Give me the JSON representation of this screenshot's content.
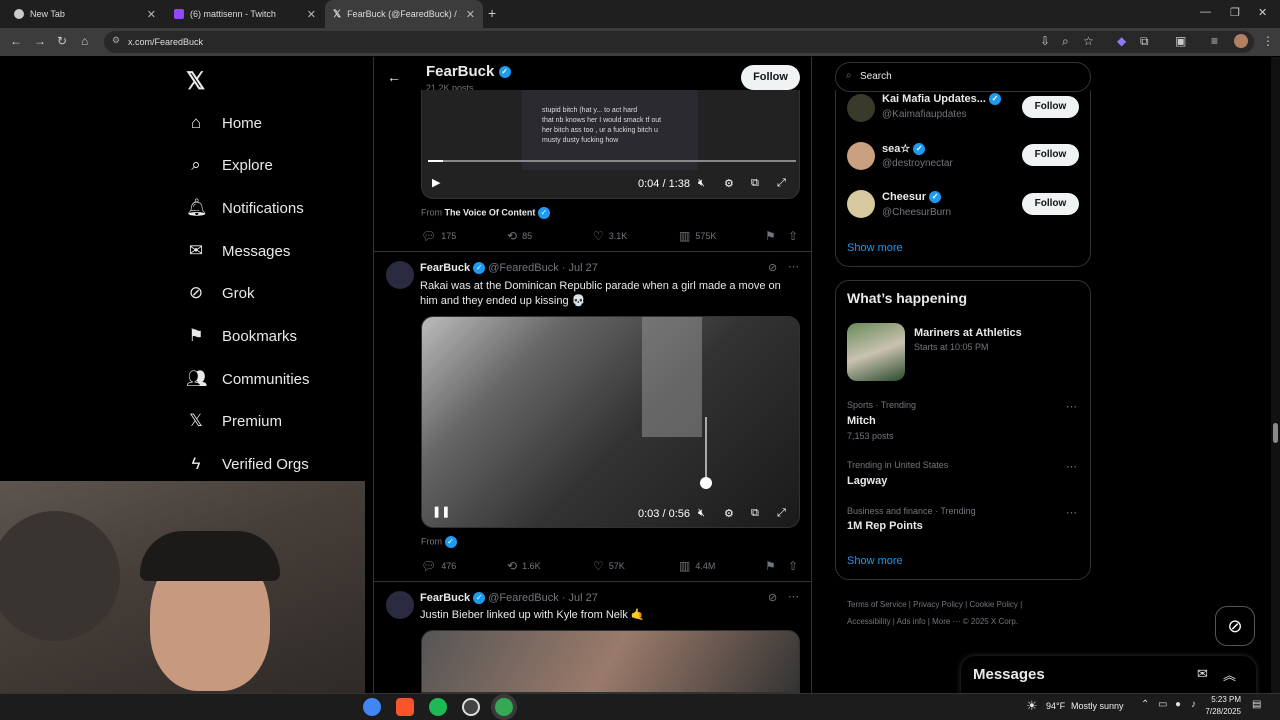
{
  "browser": {
    "tabs": [
      {
        "title": "New Tab",
        "icon": "chrome-icon"
      },
      {
        "title": "(6) mattisenn - Twitch",
        "icon": "twitch-icon"
      },
      {
        "title": "FearBuck (@FearedBuck) / X",
        "icon": "x-icon"
      }
    ],
    "url": "x.com/FearedBuck"
  },
  "sidebar": {
    "items": [
      {
        "label": "Home",
        "icon": "home-icon"
      },
      {
        "label": "Explore",
        "icon": "search-icon"
      },
      {
        "label": "Notifications",
        "icon": "bell-icon"
      },
      {
        "label": "Messages",
        "icon": "mail-icon"
      },
      {
        "label": "Grok",
        "icon": "grok-icon"
      },
      {
        "label": "Bookmarks",
        "icon": "bookmark-icon"
      },
      {
        "label": "Communities",
        "icon": "people-icon"
      },
      {
        "label": "Premium",
        "icon": "x-icon"
      },
      {
        "label": "Verified Orgs",
        "icon": "bolt-icon"
      }
    ]
  },
  "profile_header": {
    "name": "FearBuck",
    "posts": "21.2K posts",
    "follow_label": "Follow"
  },
  "post0": {
    "time": "0:04 / 1:38",
    "from_label": "From",
    "from_name": "The Voice Of Content",
    "replies": "175",
    "reposts": "85",
    "likes": "3.1K",
    "views": "575K",
    "video_text": [
      "stupid bitch (hat y... to act hard",
      "that nb knows her I would smack tf out",
      "her bitch ass too , ur a fucking bitch u",
      "musty dusty fucking how"
    ]
  },
  "post1": {
    "name": "FearBuck",
    "handle": "@FearedBuck",
    "date": "· Jul 27",
    "text": "Rakai was at the Dominican Republic parade when a girl made a move on him and they ended up kissing 💀",
    "time": "0:03 / 0:56",
    "from_label": "From",
    "replies": "476",
    "reposts": "1.6K",
    "likes": "57K",
    "views": "4.4M"
  },
  "post2": {
    "name": "FearBuck",
    "handle": "@FearedBuck",
    "date": "· Jul 27",
    "text": "Justin Bieber linked up with Kyle from Nelk 🤙"
  },
  "right": {
    "search_placeholder": "Search",
    "who_to_follow": [
      {
        "name": "Kai Mafia Updates...",
        "handle": "@Kaimafiaupdates",
        "button": "Follow"
      },
      {
        "name": "sea☆",
        "handle": "@destroynectar",
        "button": "Follow"
      },
      {
        "name": "Cheesur",
        "handle": "@CheesurBurn",
        "button": "Follow"
      }
    ],
    "show_more": "Show more",
    "happening_title": "What’s happening",
    "event": {
      "title": "Mariners at Athletics",
      "time": "Starts at 10:05 PM"
    },
    "trends": [
      {
        "meta": "Sports · Trending",
        "title": "Mitch",
        "count": "7,153 posts"
      },
      {
        "meta": "Trending in United States",
        "title": "Lagway",
        "count": ""
      },
      {
        "meta": "Business and finance · Trending",
        "title": "1M Rep Points",
        "count": ""
      }
    ],
    "show_more2": "Show more",
    "footer_links": [
      "Terms of Service",
      "Privacy Policy",
      "Cookie Policy",
      "Accessibility",
      "Ads info",
      "More ···",
      "© 2025 X Corp."
    ],
    "messages_label": "Messages"
  },
  "taskbar": {
    "weather": "94°F",
    "weather_desc": "Mostly sunny",
    "time": "5:23 PM",
    "date": "7/28/2025"
  },
  "colors": {
    "accent": "#1d9bf0",
    "bg": "#000000",
    "border": "#2f3336"
  }
}
